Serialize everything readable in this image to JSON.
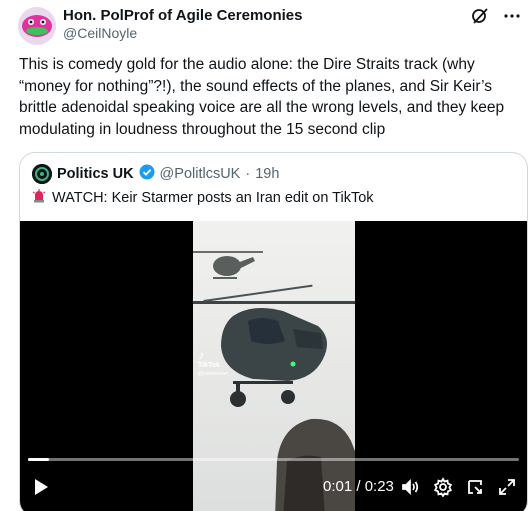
{
  "author": {
    "name": "Hon. PolProf of Agile Ceremonies",
    "handle": "@CeilNoyle"
  },
  "tweet": {
    "text": "This is comedy gold for the audio alone: the Dire Straits track (why “money for nothing”?!), the sound effects of the planes, and Sir Keir’s brittle adenoidal speaking voice are all the wrong levels, and they keep modulating in loudness throughout the 15 second clip"
  },
  "quoted": {
    "name": "Politics UK",
    "handle": "@PolitlcsUK",
    "separator": "·",
    "time": "19h",
    "text": "WATCH: Keir Starmer posts an Iran edit on TikTok",
    "icons": {
      "verified": "verified-badge-icon",
      "siren": "siren-emoji-icon"
    },
    "colors": {
      "verified": "#1d9bf0",
      "siren": "#e0245e"
    }
  },
  "video": {
    "watermark_brand": "TikTok",
    "watermark_user": "@keirstarmer",
    "time_display": "0:01 / 0:23",
    "progress_fraction": 0.043,
    "controls": [
      "play-icon",
      "volume-icon",
      "settings-gear-icon",
      "picture-in-picture-icon",
      "fullscreen-icon"
    ]
  },
  "top_icons": [
    "grok-icon",
    "more-options-icon"
  ]
}
